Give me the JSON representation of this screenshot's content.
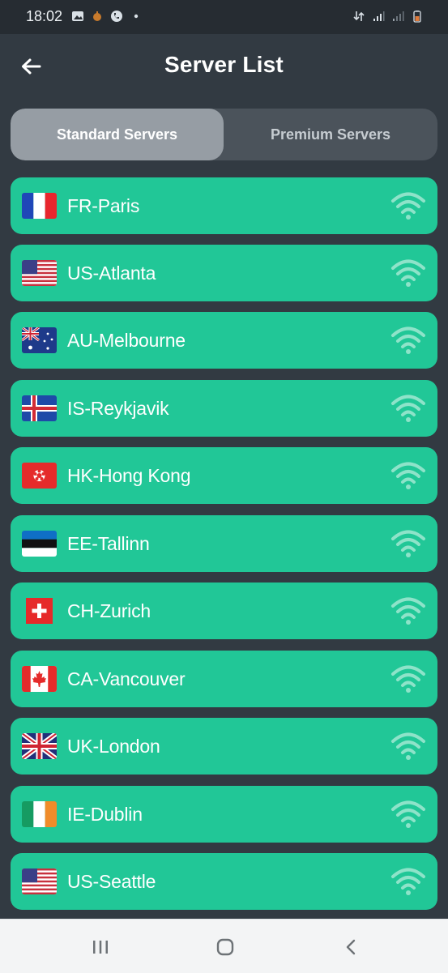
{
  "status": {
    "time": "18:02",
    "left_icons": [
      "image-icon",
      "notification-icon",
      "whatsapp-icon",
      "dot-icon"
    ],
    "right_icons": [
      "data-icon",
      "signal-icon",
      "signal-weak-icon",
      "battery-icon"
    ]
  },
  "header": {
    "title": "Server List",
    "back_icon": "arrow-left-icon"
  },
  "tabs": [
    {
      "label": "Standard Servers",
      "selected": true
    },
    {
      "label": "Premium Servers",
      "selected": false
    }
  ],
  "colors": {
    "background": "#323a42",
    "item": "#21c797",
    "tab_selected": "#969da4",
    "tab_track": "#4b535b"
  },
  "servers": [
    {
      "name": "FR-Paris",
      "flag": "fr"
    },
    {
      "name": "US-Atlanta",
      "flag": "us"
    },
    {
      "name": "AU-Melbourne",
      "flag": "au"
    },
    {
      "name": "IS-Reykjavik",
      "flag": "is"
    },
    {
      "name": "HK-Hong Kong",
      "flag": "hk"
    },
    {
      "name": "EE-Tallinn",
      "flag": "ee"
    },
    {
      "name": "CH-Zurich",
      "flag": "ch"
    },
    {
      "name": "CA-Vancouver",
      "flag": "ca"
    },
    {
      "name": "UK-London",
      "flag": "uk"
    },
    {
      "name": "IE-Dublin",
      "flag": "ie"
    },
    {
      "name": "US-Seattle",
      "flag": "us"
    }
  ],
  "nav": {
    "recent_icon": "recent-apps-icon",
    "home_icon": "home-icon",
    "back_icon": "back-icon"
  }
}
